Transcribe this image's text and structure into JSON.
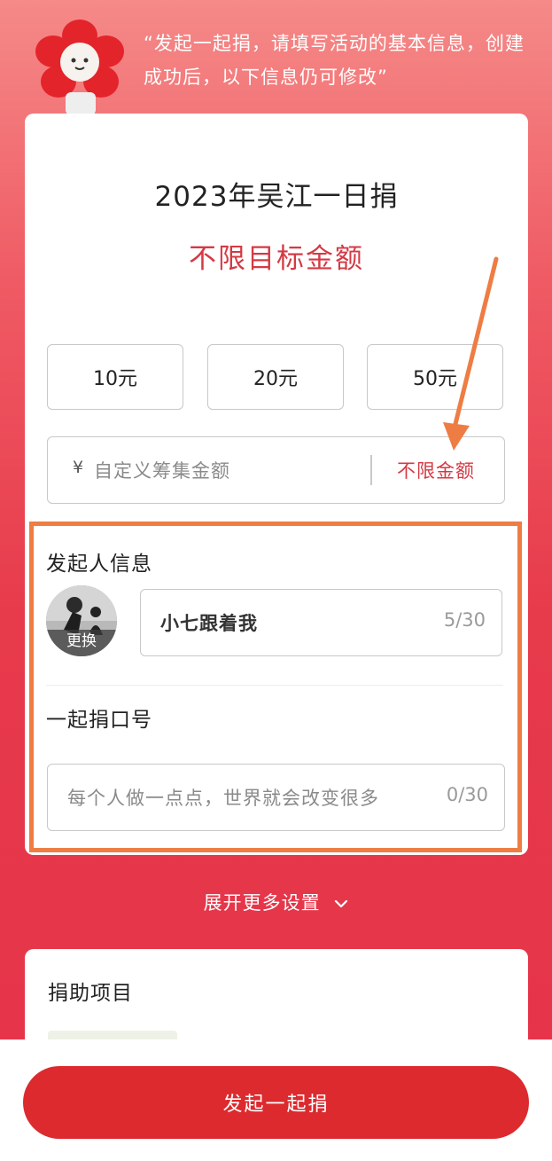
{
  "intro": {
    "text": "“发起一起捐，请填写活动的基本信息，创建成功后，以下信息仍可修改”"
  },
  "campaign": {
    "title": "2023年吴江一日捐",
    "goal_text": "不限目标金额"
  },
  "amounts": {
    "option1": "10元",
    "option2": "20元",
    "option3": "50元"
  },
  "custom_amount": {
    "currency": "¥",
    "placeholder": "自定义筹集金额",
    "unlimited_label": "不限金额"
  },
  "initiator": {
    "section_title": "发起人信息",
    "change_avatar_label": "更换",
    "name_value": "小七跟着我",
    "name_counter": "5/30"
  },
  "slogan": {
    "section_title": "一起捐口号",
    "placeholder": "每个人做一点点，世界就会改变很多",
    "counter": "0/30"
  },
  "expand": {
    "label": "展开更多设置"
  },
  "project": {
    "section_title": "捐助项目"
  },
  "footer": {
    "button_label": "发起一起捐"
  },
  "colors": {
    "accent_red": "#d43a44",
    "button_red": "#dc2a2e",
    "highlight_orange": "#ee7d44",
    "background_red": "#e5334a"
  }
}
